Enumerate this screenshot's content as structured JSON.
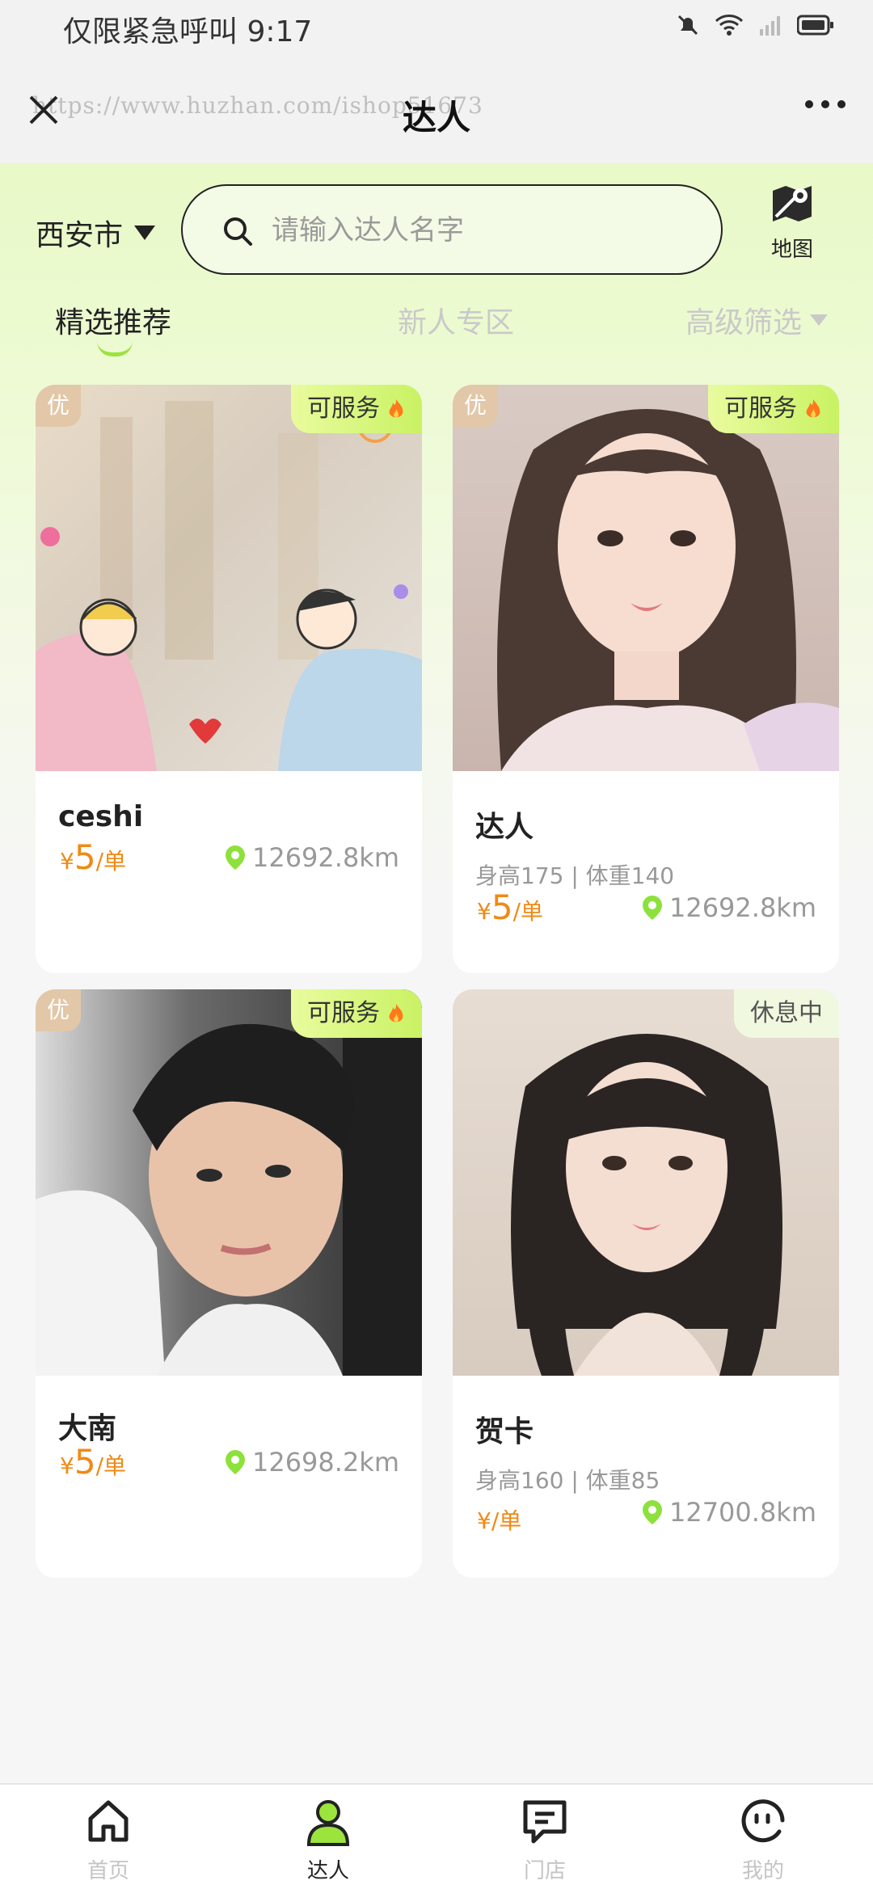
{
  "status_bar": {
    "text": "仅限紧急呼叫 9:17"
  },
  "nav": {
    "title": "达人",
    "watermark": "https://www.huzhan.com/ishop51673"
  },
  "search": {
    "city": "西安市",
    "placeholder": "请输入达人名字",
    "map_label": "地图"
  },
  "tabs": [
    {
      "label": "精选推荐",
      "active": true
    },
    {
      "label": "新人专区",
      "active": false
    },
    {
      "label": "高级筛选",
      "active": false
    }
  ],
  "cards": [
    {
      "badge": "优",
      "status": "可服务",
      "status_icon": "fire-icon",
      "name": "ceshi",
      "meta": "",
      "currency": "¥",
      "price": "5",
      "unit": "/单",
      "distance": "12692.8km"
    },
    {
      "badge": "优",
      "status": "可服务",
      "status_icon": "fire-icon",
      "name": "达人",
      "meta": "身高175 | 体重140",
      "currency": "¥",
      "price": "5",
      "unit": "/单",
      "distance": "12692.8km"
    },
    {
      "badge": "优",
      "status": "可服务",
      "status_icon": "fire-icon",
      "name": "大南",
      "meta": "",
      "currency": "¥",
      "price": "5",
      "unit": "/单",
      "distance": "12698.2km"
    },
    {
      "badge": "",
      "status": "休息中",
      "status_icon": "",
      "name": "贺卡",
      "meta": "身高160 | 体重85",
      "currency": "¥",
      "price": "",
      "unit": "/单",
      "distance": "12700.8km"
    }
  ],
  "tabbar": [
    {
      "label": "首页",
      "icon": "home-icon",
      "active": false
    },
    {
      "label": "达人",
      "icon": "person-icon",
      "active": true
    },
    {
      "label": "门店",
      "icon": "message-icon",
      "active": false
    },
    {
      "label": "我的",
      "icon": "face-icon",
      "active": false
    }
  ],
  "colors": {
    "accent": "#9be33d",
    "price": "#f08a15",
    "status_on": "#c9f263"
  }
}
